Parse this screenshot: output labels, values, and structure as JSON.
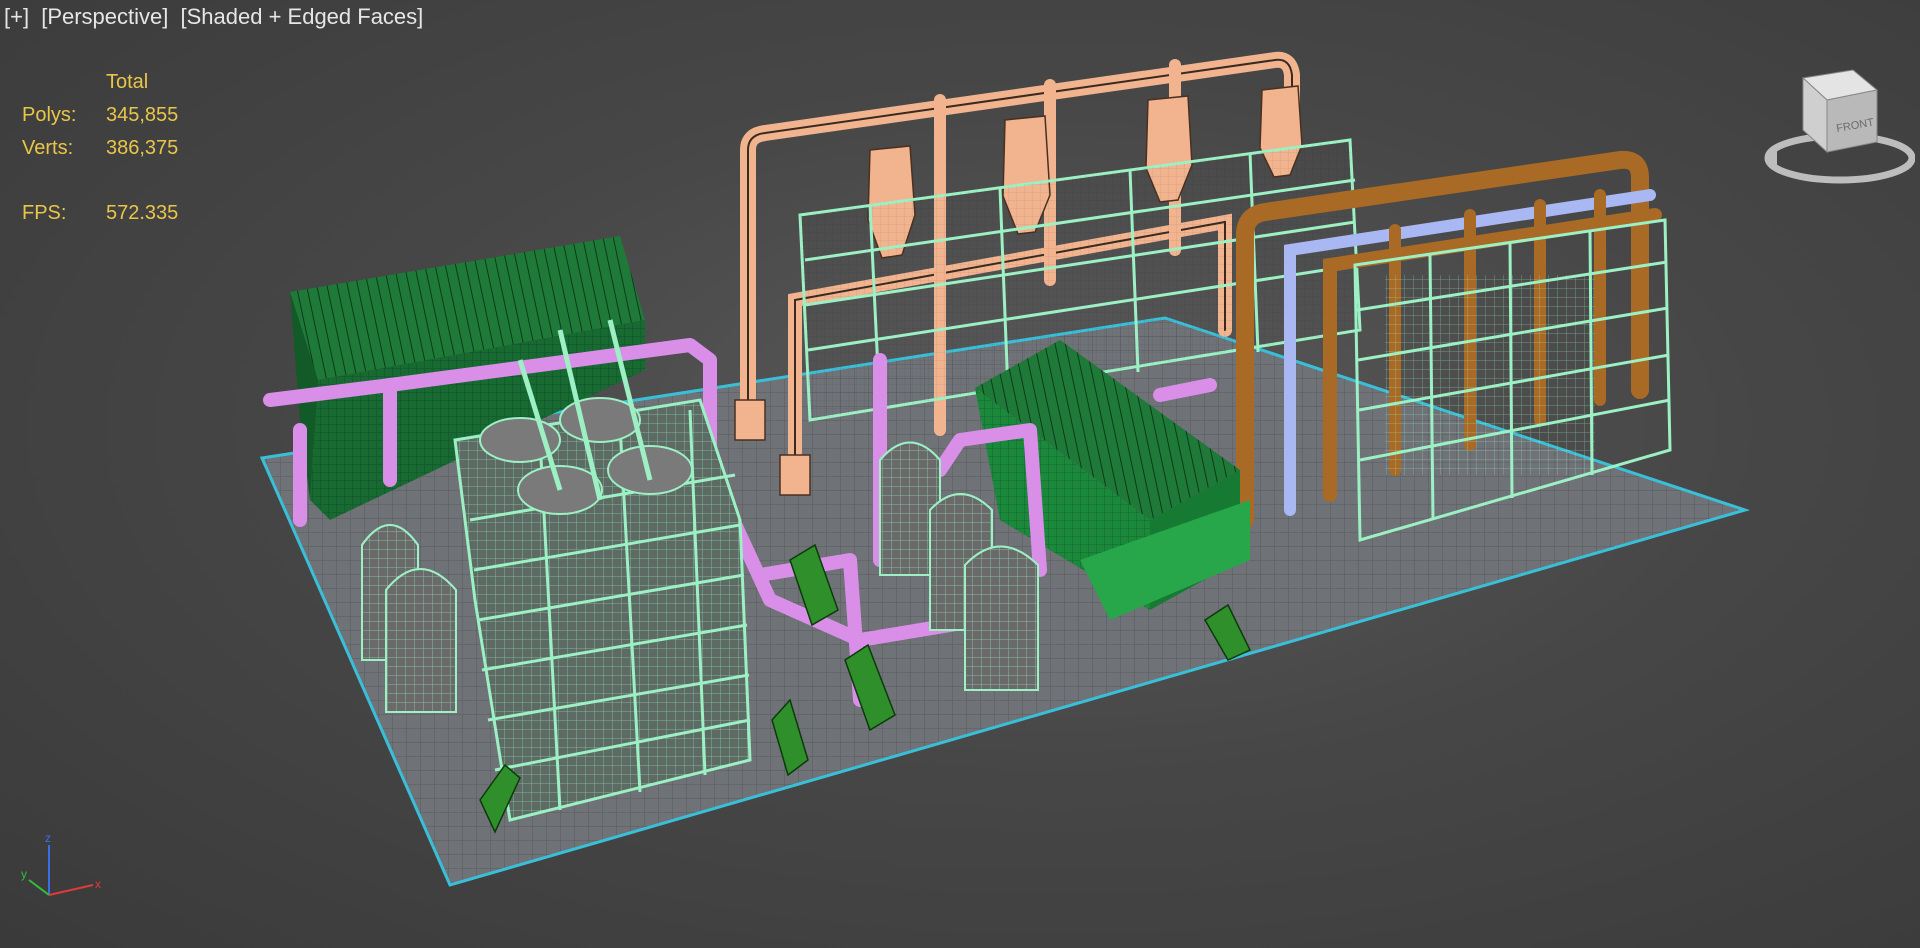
{
  "viewport": {
    "labels": [
      "[+]",
      "[Perspective]",
      "[Shaded + Edged Faces]"
    ]
  },
  "stats": {
    "header": "Total",
    "polys_label": "Polys:",
    "polys_value": "345,855",
    "verts_label": "Verts:",
    "verts_value": "386,375",
    "fps_label": "FPS:",
    "fps_value": "572.335"
  },
  "viewcube": {
    "face_label": "FRONT"
  },
  "axis": {
    "x": "x",
    "y": "y",
    "z": "z"
  },
  "colors": {
    "ground": "#6f7277",
    "ground_edge": "#39c0d8",
    "mint": "#9cf0c4",
    "peach": "#f2b48f",
    "pink": "#d98ee8",
    "dark_green": "#1f7a3a",
    "brown": "#a86a24",
    "lavender": "#a9b7f2",
    "stats_text": "#e9c64a"
  }
}
